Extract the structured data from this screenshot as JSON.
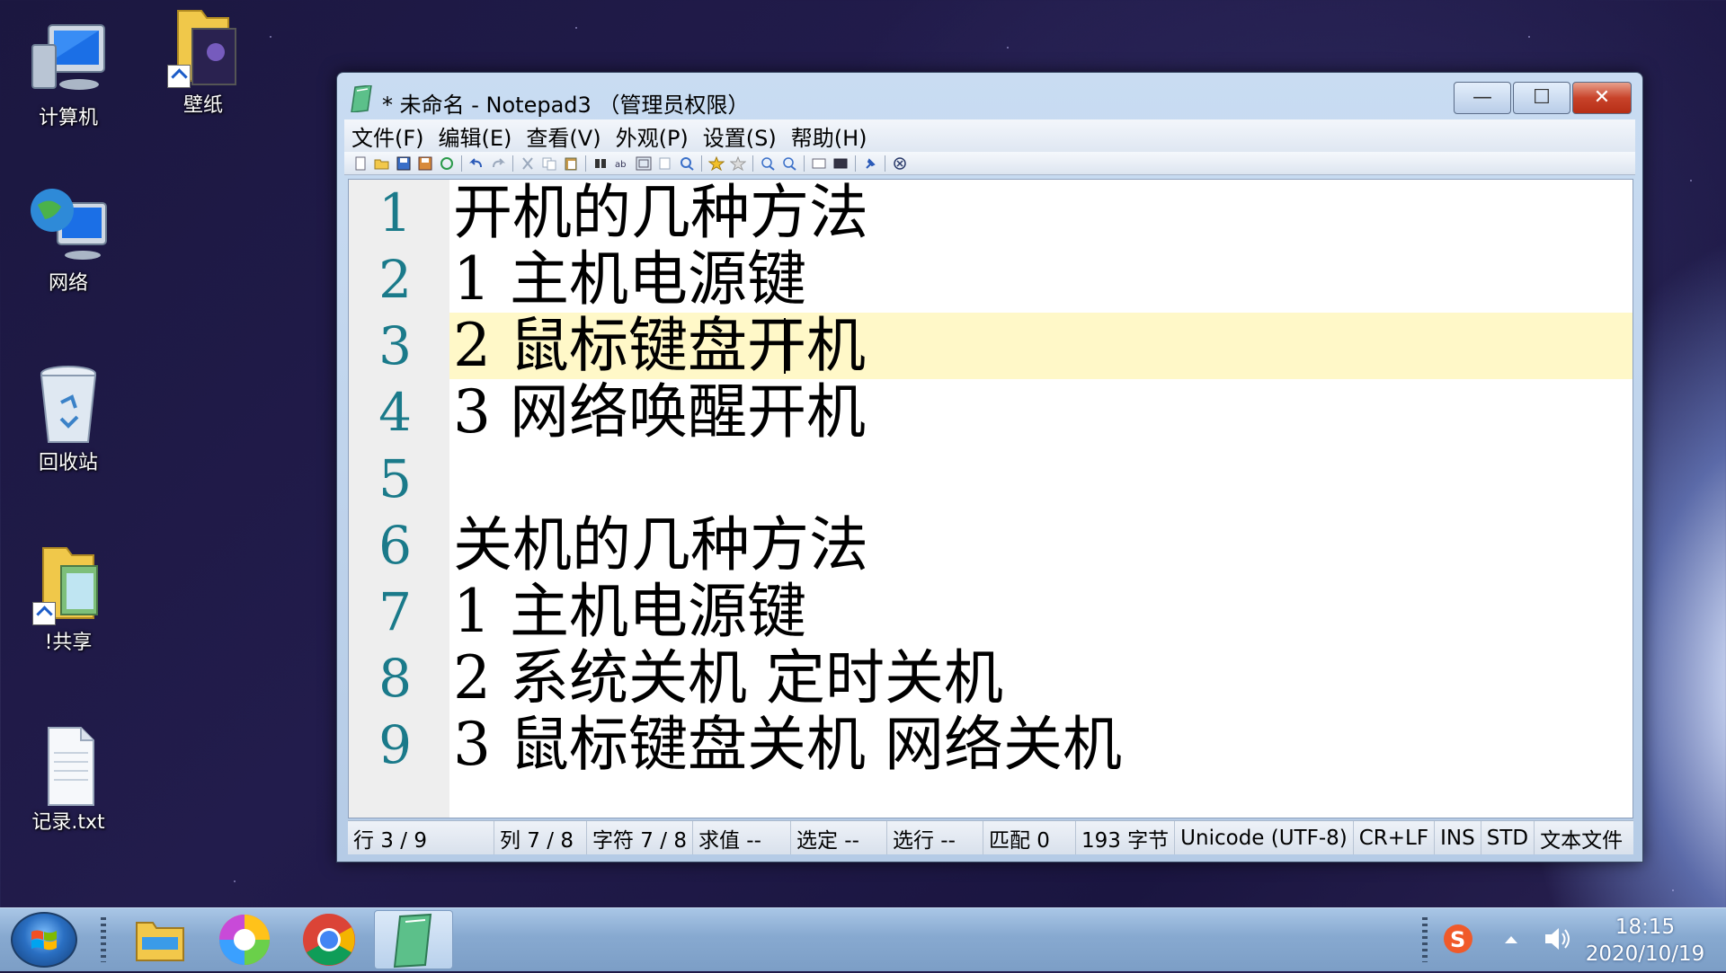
{
  "desktop": {
    "icons": [
      {
        "label": "计算机",
        "icon": "computer-icon"
      },
      {
        "label": "壁纸",
        "icon": "folder-icon"
      },
      {
        "label": "网络",
        "icon": "network-icon"
      },
      {
        "label": "回收站",
        "icon": "recycle-bin-icon"
      },
      {
        "label": "!共享",
        "icon": "folder-icon"
      },
      {
        "label": "记录.txt",
        "icon": "text-file-icon"
      }
    ]
  },
  "window": {
    "title": "* 未命名 - Notepad3 （管理员权限）",
    "controls": {
      "minimize": "—",
      "maximize": "☐",
      "close": "✕"
    },
    "menu": [
      "文件(F)",
      "编辑(E)",
      "查看(V)",
      "外观(P)",
      "设置(S)",
      "帮助(H)"
    ],
    "lines": [
      {
        "num": "1",
        "text": "开机的几种方法"
      },
      {
        "num": "2",
        "text": "1 主机电源键"
      },
      {
        "num": "3",
        "text": "2 鼠标键盘开机"
      },
      {
        "num": "4",
        "text": "3 网络唤醒开机"
      },
      {
        "num": "5",
        "text": ""
      },
      {
        "num": "6",
        "text": "关机的几种方法"
      },
      {
        "num": "7",
        "text": "1 主机电源键"
      },
      {
        "num": "8",
        "text": "2 系统关机 定时关机"
      },
      {
        "num": "9",
        "text": "3 鼠标键盘关机 网络关机"
      }
    ],
    "current_line": 3,
    "status": {
      "line": "行 3 / 9",
      "col": "列 7 / 8",
      "char": "字符 7 / 8",
      "eval": "求值 --",
      "sel": "选定 --",
      "sel_lines": "选行 --",
      "match": "匹配 0",
      "bytes": "193 字节",
      "encoding": "Unicode (UTF-8)",
      "eol": "CR+LF",
      "ins": "INS",
      "std": "STD",
      "filetype": "文本文件"
    }
  },
  "taskbar": {
    "clock_time": "18:15",
    "clock_date": "2020/10/19",
    "apps": [
      "file-explorer-icon",
      "360-browser-icon",
      "chrome-icon",
      "notepad3-icon"
    ]
  }
}
